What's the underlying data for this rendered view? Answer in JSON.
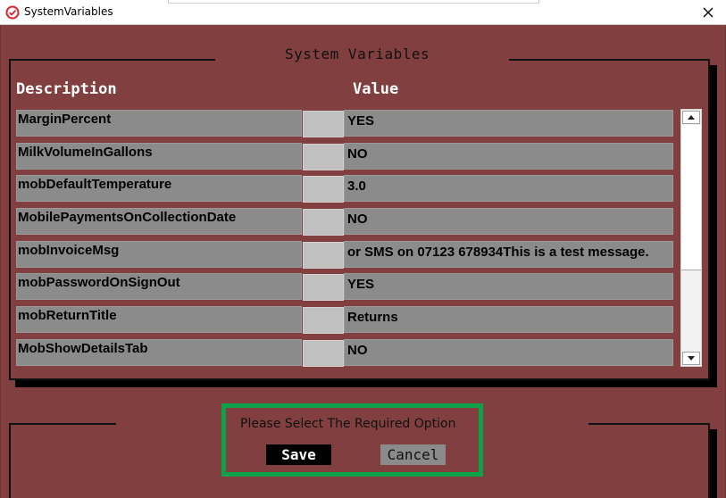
{
  "window": {
    "title": "SystemVariables",
    "icon": "app-logo-icon",
    "close_icon": "close-icon"
  },
  "dialog": {
    "heading": "System Variables",
    "columns": {
      "description": "Description",
      "value": "Value"
    },
    "rows": [
      {
        "description": "MarginPercent",
        "value": "YES"
      },
      {
        "description": "MilkVolumeInGallons",
        "value": "NO"
      },
      {
        "description": "mobDefaultTemperature",
        "value": "3.0"
      },
      {
        "description": "MobilePaymentsOnCollectionDate",
        "value": "NO"
      },
      {
        "description": "mobInvoiceMsg",
        "value": " or SMS on 07123 678934This is a test message."
      },
      {
        "description": "mobPasswordOnSignOut",
        "value": "YES"
      },
      {
        "description": "mobReturnTitle",
        "value": "Returns"
      },
      {
        "description": "MobShowDetailsTab",
        "value": "NO"
      }
    ],
    "scrollbar": {
      "up_icon": "scroll-up-arrow-icon",
      "down_icon": "scroll-down-arrow-icon"
    }
  },
  "options": {
    "prompt": "Please Select The Required Option",
    "save_label": "Save",
    "cancel_label": "Cancel"
  },
  "colors": {
    "background": "#813f3f",
    "field": "#8b8b8b",
    "highlight": "#0da24a"
  }
}
